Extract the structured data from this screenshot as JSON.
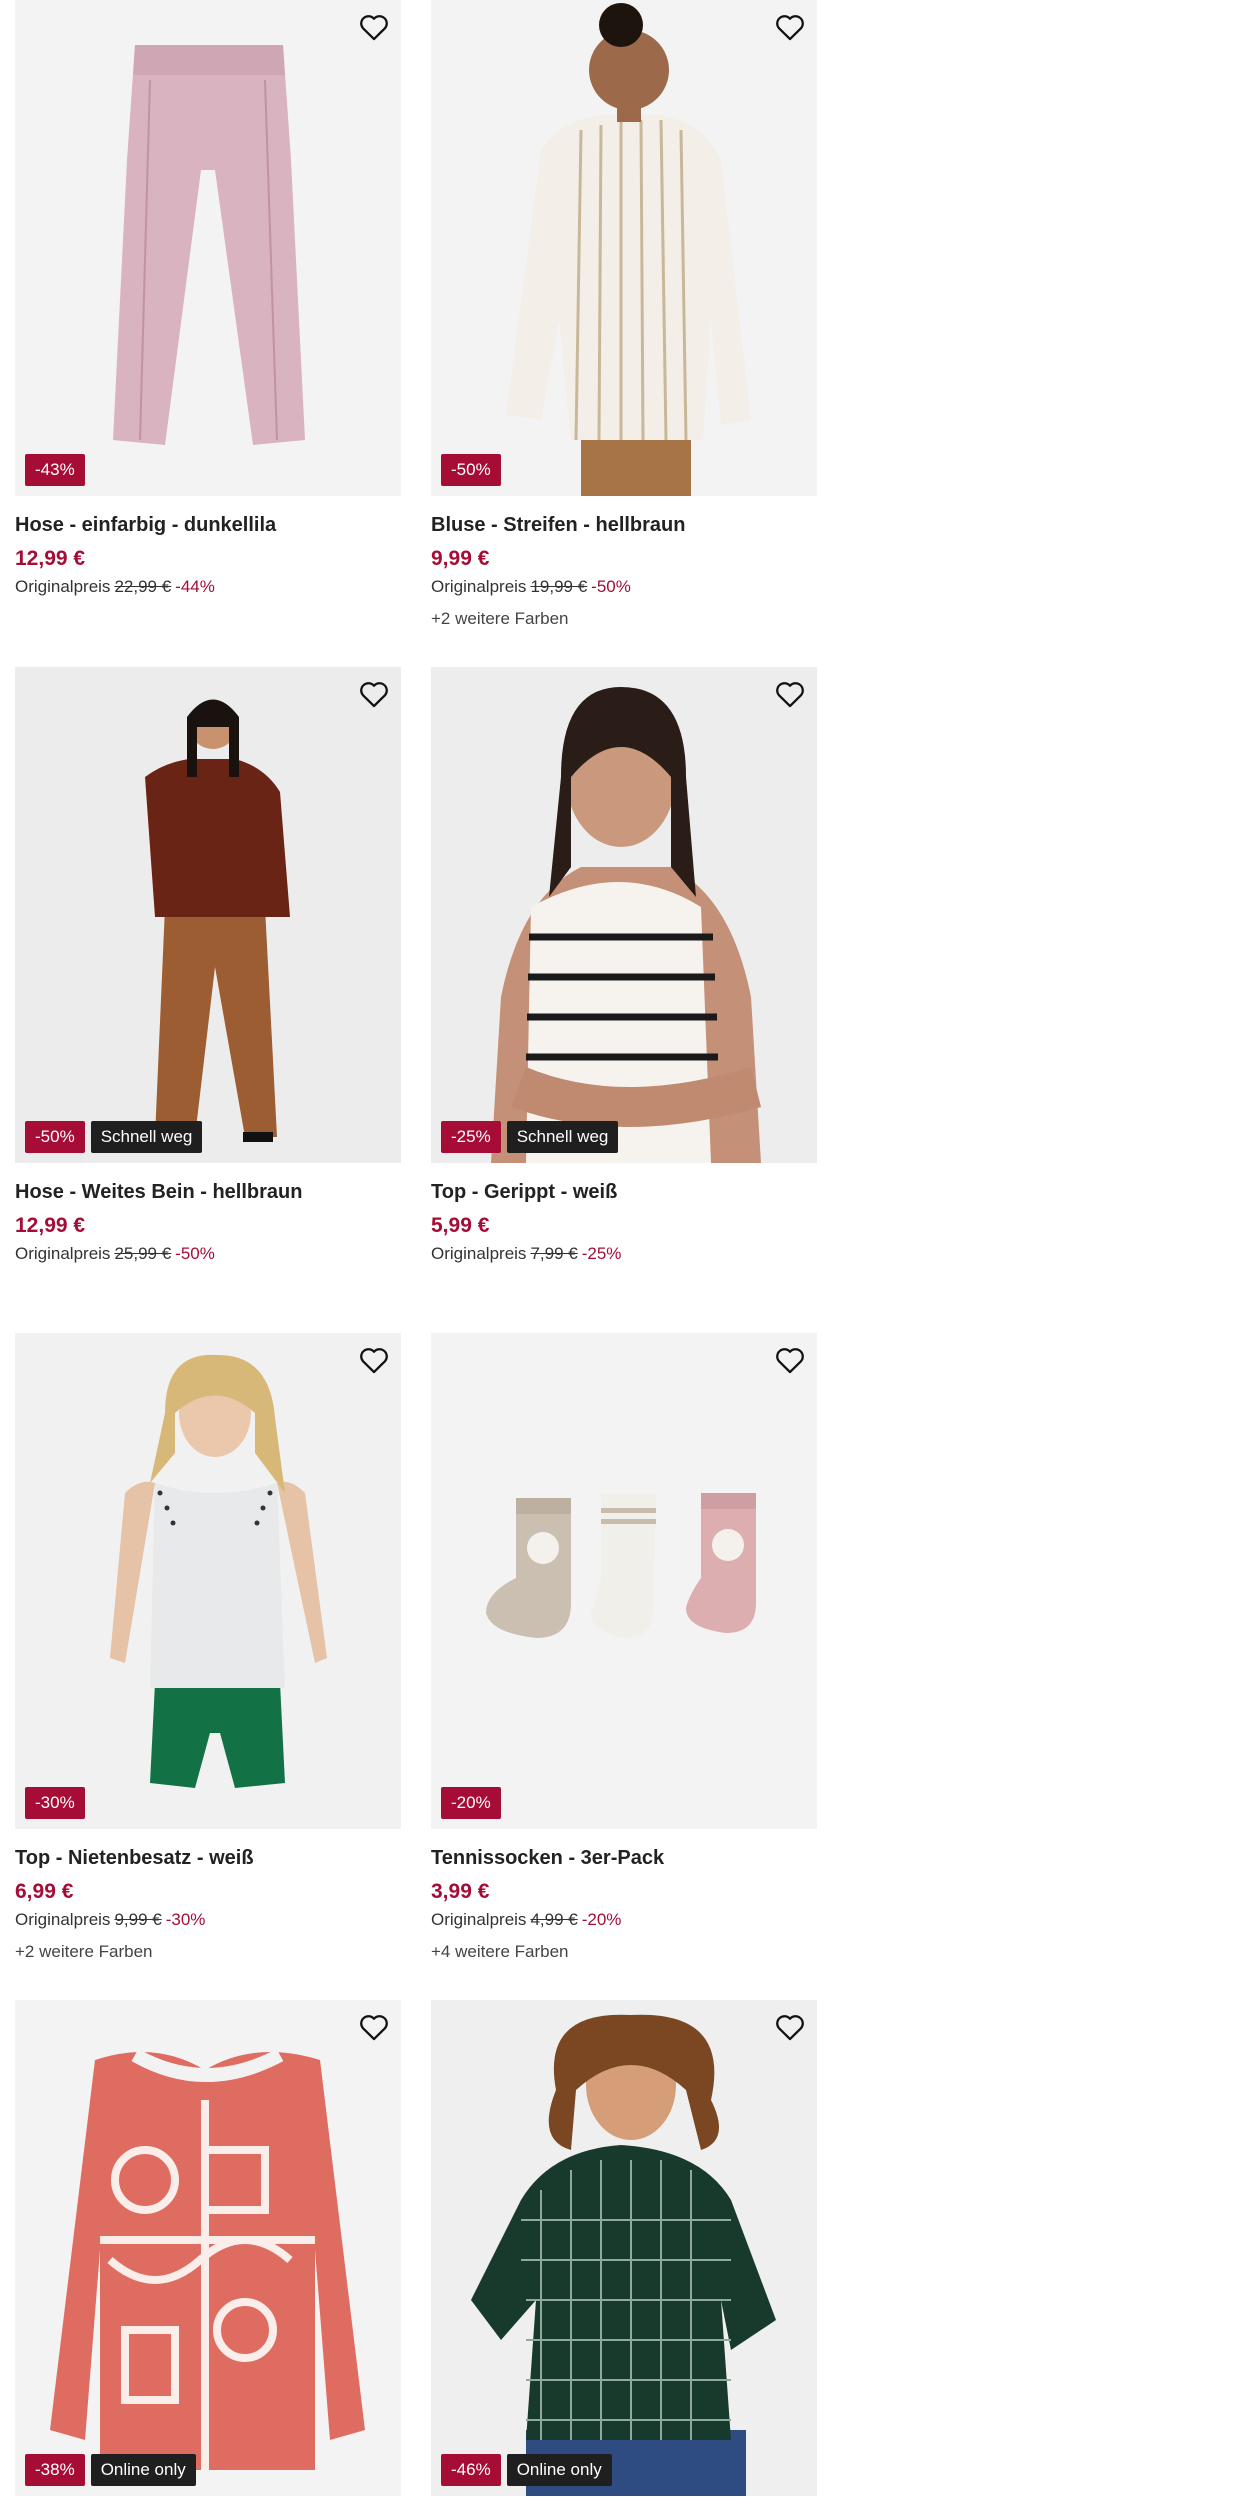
{
  "products": [
    {
      "title": "Hose - einfarbig - dunkellila",
      "price": "12,99 €",
      "orig_label": "Originalpreis",
      "orig_price": "22,99 €",
      "orig_pct": "-44%",
      "badge": "-43%",
      "flag": "",
      "colors": ""
    },
    {
      "title": "Bluse - Streifen - hellbraun",
      "price": "9,99 €",
      "orig_label": "Originalpreis",
      "orig_price": "19,99 €",
      "orig_pct": "-50%",
      "badge": "-50%",
      "flag": "",
      "colors": "+2 weitere Farben"
    },
    {
      "title": "Hose - Weites Bein - hellbraun",
      "price": "12,99 €",
      "orig_label": "Originalpreis",
      "orig_price": "25,99 €",
      "orig_pct": "-50%",
      "badge": "-50%",
      "flag": "Schnell weg",
      "colors": ""
    },
    {
      "title": "Top - Gerippt - weiß",
      "price": "5,99 €",
      "orig_label": "Originalpreis",
      "orig_price": "7,99 €",
      "orig_pct": "-25%",
      "badge": "-25%",
      "flag": "Schnell weg",
      "colors": ""
    },
    {
      "title": "Top - Nietenbesatz - weiß",
      "price": "6,99 €",
      "orig_label": "Originalpreis",
      "orig_price": "9,99 €",
      "orig_pct": "-30%",
      "badge": "-30%",
      "flag": "",
      "colors": "+2 weitere Farben"
    },
    {
      "title": "Tennissocken - 3er-Pack",
      "price": "3,99 €",
      "orig_label": "Originalpreis",
      "orig_price": "4,99 €",
      "orig_pct": "-20%",
      "badge": "-20%",
      "flag": "",
      "colors": "+4 weitere Farben"
    },
    {
      "title": "",
      "price": "",
      "orig_label": "",
      "orig_price": "",
      "orig_pct": "",
      "badge": "-38%",
      "flag": "Online only",
      "colors": ""
    },
    {
      "title": "",
      "price": "",
      "orig_label": "",
      "orig_price": "",
      "orig_pct": "",
      "badge": "-46%",
      "flag": "Online only",
      "colors": ""
    }
  ],
  "colors": {
    "sale": "#a50d36",
    "flag_bg": "#1f1f1f",
    "tile_bg": "#f3f3f3"
  },
  "icons": {
    "wishlist": "heart-outline-icon"
  }
}
